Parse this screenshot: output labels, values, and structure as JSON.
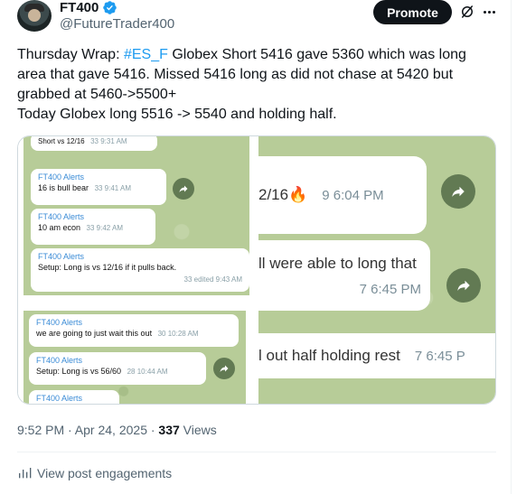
{
  "author": {
    "display_name": "FT400",
    "handle": "@FutureTrader400",
    "verified": true
  },
  "actions": {
    "promote_label": "Promote"
  },
  "post": {
    "line1_pre": "Thursday Wrap:  ",
    "line1_hashtag": "#ES_F",
    "line1_post": "  Globex Short 5416 gave 5360 which was long",
    "line2": "area that gave 5416.  Missed 5416 long as did not chase at 5420 but",
    "line3": "grabbed at 5460->5500+",
    "line4": "Today Globex long 5516 -> 5540 and holding half."
  },
  "media": {
    "shot1": {
      "top_fragment": "Short vs 12/16",
      "top_meta": "33  9:31 AM",
      "msgs": [
        {
          "sender": "FT400 Alerts",
          "text": "16 is bull bear",
          "meta": "33  9:41 AM"
        },
        {
          "sender": "FT400 Alerts",
          "text": "10 am econ",
          "meta": "33  9:42 AM"
        },
        {
          "sender": "FT400 Alerts",
          "text": "Setup: Long is vs 12/16 if it pulls back.",
          "meta": "33  edited 9:43 AM"
        }
      ]
    },
    "shot2": {
      "msgs": [
        {
          "sender": "FT400 Alerts",
          "text": "we are going to just wait this out",
          "meta": "30  10:28 AM"
        },
        {
          "sender": "FT400 Alerts",
          "text": "Setup: Long is vs 56/60",
          "meta": "28  10:44 AM"
        },
        {
          "sender": "FT400 Alerts",
          "text": "",
          "meta": ""
        }
      ]
    },
    "shot3": {
      "msgs": [
        {
          "text": "2/16🔥",
          "meta": "9  6:04 PM"
        },
        {
          "text": "ll were able to long that",
          "meta": "7  6:45 PM"
        },
        {
          "text": "l out half holding rest",
          "meta": "7  6:45 P"
        }
      ]
    }
  },
  "footer": {
    "time": "9:52 PM · Apr 24, 2025 · ",
    "views_count": "337",
    "views_label": " Views",
    "engagements_label": "View post engagements"
  },
  "colors": {
    "accent": "#1d9bf0",
    "chat_bg": "#b7cc98",
    "sender": "#3a8bd6"
  }
}
